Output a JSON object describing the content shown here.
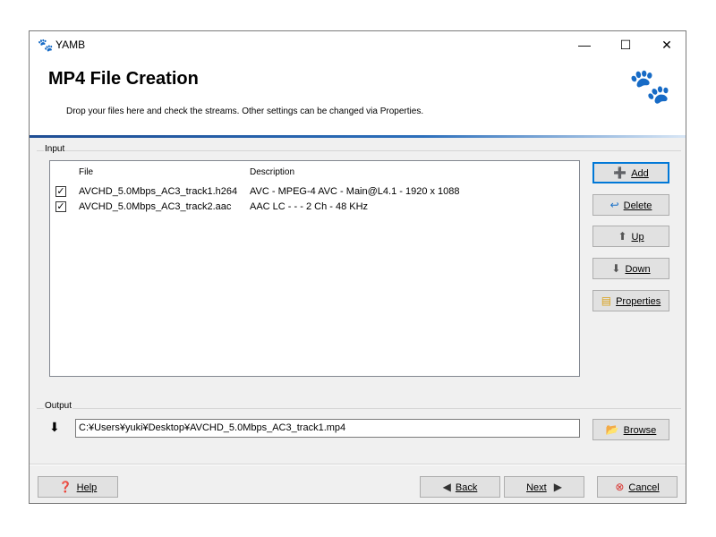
{
  "window": {
    "title": "YAMB",
    "minimize": "—",
    "maximize": "☐",
    "close": "✕"
  },
  "header": {
    "title": "MP4 File Creation",
    "subtitle": "Drop your files here and check the streams. Other settings can be changed via Properties."
  },
  "input": {
    "group_label": "Input",
    "columns": [
      "File",
      "Description"
    ],
    "rows": [
      {
        "checked": true,
        "file": "AVCHD_5.0Mbps_AC3_track1.h264",
        "description": "AVC - MPEG-4 AVC - Main@L4.1 - 1920 x 1088"
      },
      {
        "checked": true,
        "file": "AVCHD_5.0Mbps_AC3_track2.aac",
        "description": "AAC LC - - - 2 Ch - 48 KHz"
      }
    ],
    "buttons": {
      "add": "Add",
      "delete": "Delete",
      "up": "Up",
      "down": "Down",
      "properties": "Properties"
    }
  },
  "output": {
    "group_label": "Output",
    "path": "C:¥Users¥yuki¥Desktop¥AVCHD_5.0Mbps_AC3_track1.mp4",
    "browse": "Browse"
  },
  "footer": {
    "help": "Help",
    "back": "Back",
    "next": "Next",
    "cancel": "Cancel"
  },
  "colors": {
    "header_accent": "#1f4e94",
    "default_button_border": "#0078d7"
  }
}
